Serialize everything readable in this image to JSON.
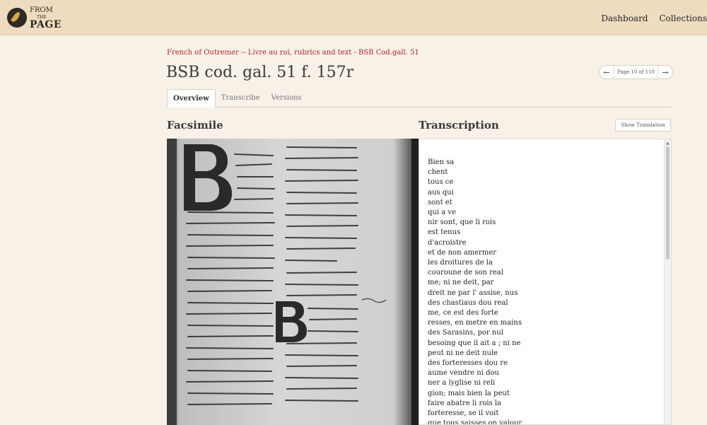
{
  "header": {
    "logo": {
      "line1": "FROM",
      "line2": "THE",
      "line3": "PAGE"
    },
    "nav": [
      "Dashboard",
      "Collections"
    ]
  },
  "breadcrumb": "French of Outremer -- Livre au roi, rubrics and text - BSB Cod.gall. 51",
  "title": "BSB cod. gal. 51 f. 157r",
  "pager": {
    "label": "Page 10 of 110",
    "prev": "←",
    "next": "→"
  },
  "tabs": [
    "Overview",
    "Transcribe",
    "Versions"
  ],
  "sections": {
    "facsimile": "Facsimile",
    "transcription": "Transcription"
  },
  "show_translation": "Show Translation",
  "transcription_lines": [
    "Bien sa",
    "chent",
    "tous ce",
    "aus qui",
    "sont et",
    "qui a ve",
    "nir sont, que li rois",
    "est tenus",
    "d'acroistre",
    "et de non amermer",
    "les droitures de la",
    "couroune de son real",
    "me; ni ne deit, par",
    "dreit ne par l' assise, nus",
    "des chastiaus dou real",
    "me, ce est des forte",
    "resses, en metre en mains",
    "des Sarasins, por nul",
    "besoing que il ait a ; ni ne",
    "peut ni ne deit nule",
    "des forteresses dou re",
    "aume vendre ni dou",
    "ner a lyglise ni reli",
    "gion; mais bien la peut",
    "faire abatre li rois la",
    "forteresse, se il voit",
    "que tous saisses on valour"
  ],
  "icons": {
    "logo": "quill-logo-icon",
    "scroll_up": "chevron-up-icon"
  },
  "colors": {
    "header_bg": "#efdcc0",
    "page_bg": "#f7f1e8",
    "breadcrumb": "#b3232a"
  }
}
